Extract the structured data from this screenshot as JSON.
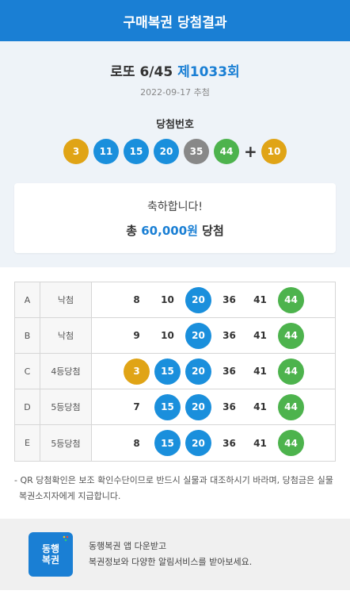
{
  "header": {
    "title": "구매복권 당첨결과"
  },
  "draw": {
    "game": "로또 6/45",
    "round": "제1033회",
    "date": "2022-09-17 추첨",
    "win_label": "당첨번호",
    "numbers": [
      {
        "value": "3",
        "color": "#e0a416"
      },
      {
        "value": "11",
        "color": "#1a8fdc"
      },
      {
        "value": "15",
        "color": "#1a8fdc"
      },
      {
        "value": "20",
        "color": "#1a8fdc"
      },
      {
        "value": "35",
        "color": "#888888"
      },
      {
        "value": "44",
        "color": "#4db34d"
      }
    ],
    "plus": "+",
    "bonus": {
      "value": "10",
      "color": "#e0a416"
    }
  },
  "result": {
    "congrats": "축하합니다!",
    "prefix": "총",
    "amount": "60,000원",
    "suffix": "당첨"
  },
  "tickets": [
    {
      "label": "A",
      "result": "낙첨",
      "numbers": [
        {
          "value": "8",
          "hit": false
        },
        {
          "value": "10",
          "hit": false
        },
        {
          "value": "20",
          "hit": true,
          "color": "#1a8fdc"
        },
        {
          "value": "36",
          "hit": false
        },
        {
          "value": "41",
          "hit": false
        },
        {
          "value": "44",
          "hit": true,
          "color": "#4db34d"
        }
      ]
    },
    {
      "label": "B",
      "result": "낙첨",
      "numbers": [
        {
          "value": "9",
          "hit": false
        },
        {
          "value": "10",
          "hit": false
        },
        {
          "value": "20",
          "hit": true,
          "color": "#1a8fdc"
        },
        {
          "value": "36",
          "hit": false
        },
        {
          "value": "41",
          "hit": false
        },
        {
          "value": "44",
          "hit": true,
          "color": "#4db34d"
        }
      ]
    },
    {
      "label": "C",
      "result": "4등당첨",
      "numbers": [
        {
          "value": "3",
          "hit": true,
          "color": "#e0a416"
        },
        {
          "value": "15",
          "hit": true,
          "color": "#1a8fdc"
        },
        {
          "value": "20",
          "hit": true,
          "color": "#1a8fdc"
        },
        {
          "value": "36",
          "hit": false
        },
        {
          "value": "41",
          "hit": false
        },
        {
          "value": "44",
          "hit": true,
          "color": "#4db34d"
        }
      ]
    },
    {
      "label": "D",
      "result": "5등당첨",
      "numbers": [
        {
          "value": "7",
          "hit": false
        },
        {
          "value": "15",
          "hit": true,
          "color": "#1a8fdc"
        },
        {
          "value": "20",
          "hit": true,
          "color": "#1a8fdc"
        },
        {
          "value": "36",
          "hit": false
        },
        {
          "value": "41",
          "hit": false
        },
        {
          "value": "44",
          "hit": true,
          "color": "#4db34d"
        }
      ]
    },
    {
      "label": "E",
      "result": "5등당첨",
      "numbers": [
        {
          "value": "8",
          "hit": false
        },
        {
          "value": "15",
          "hit": true,
          "color": "#1a8fdc"
        },
        {
          "value": "20",
          "hit": true,
          "color": "#1a8fdc"
        },
        {
          "value": "36",
          "hit": false
        },
        {
          "value": "41",
          "hit": false
        },
        {
          "value": "44",
          "hit": true,
          "color": "#4db34d"
        }
      ]
    }
  ],
  "notice": {
    "line1": "- QR 당첨확인은 보조 확인수단이므로 반드시 실물과 대조하시기 바라며, 당첨금은 실물",
    "line2": "복권소지자에게 지급합니다."
  },
  "app_banner": {
    "logo_line1": "동행",
    "logo_line2": "복권",
    "logo_icon": "sparkle-icon",
    "line1": "동행복권 앱 다운받고",
    "line2": "복권정보와 다양한 알림서비스를 받아보세요."
  },
  "colors": {
    "brand": "#1a7fd4",
    "yellow": "#e0a416",
    "blue": "#1a8fdc",
    "gray": "#888888",
    "green": "#4db34d"
  }
}
